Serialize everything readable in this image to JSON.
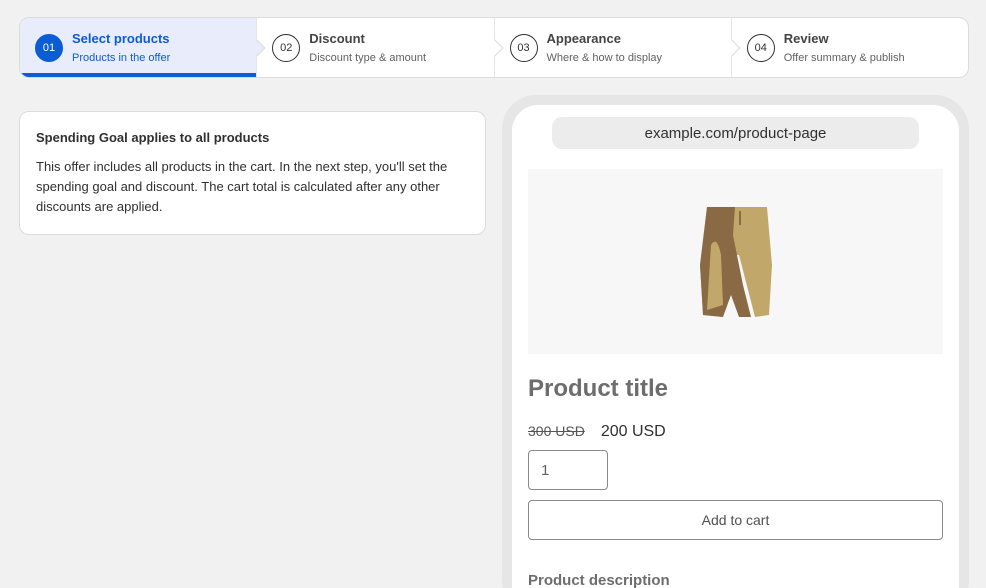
{
  "stepper": {
    "steps": [
      {
        "num": "01",
        "title": "Select products",
        "sub": "Products in the offer",
        "active": true
      },
      {
        "num": "02",
        "title": "Discount",
        "sub": "Discount type & amount",
        "active": false
      },
      {
        "num": "03",
        "title": "Appearance",
        "sub": "Where & how to display",
        "active": false
      },
      {
        "num": "04",
        "title": "Review",
        "sub": "Offer summary & publish",
        "active": false
      }
    ],
    "accent_color": "#0b5cd5"
  },
  "info": {
    "title": "Spending Goal applies to all products",
    "body": "This offer includes all products in the cart. In the next step, you'll set the spending goal and discount. The cart total is calculated after any other discounts are applied."
  },
  "preview": {
    "url": "example.com/product-page",
    "product_image": "shorts-image",
    "product_title": "Product title",
    "old_price": "300 USD",
    "new_price": "200 USD",
    "quantity": "1",
    "add_to_cart_label": "Add to cart",
    "description_heading": "Product description"
  }
}
